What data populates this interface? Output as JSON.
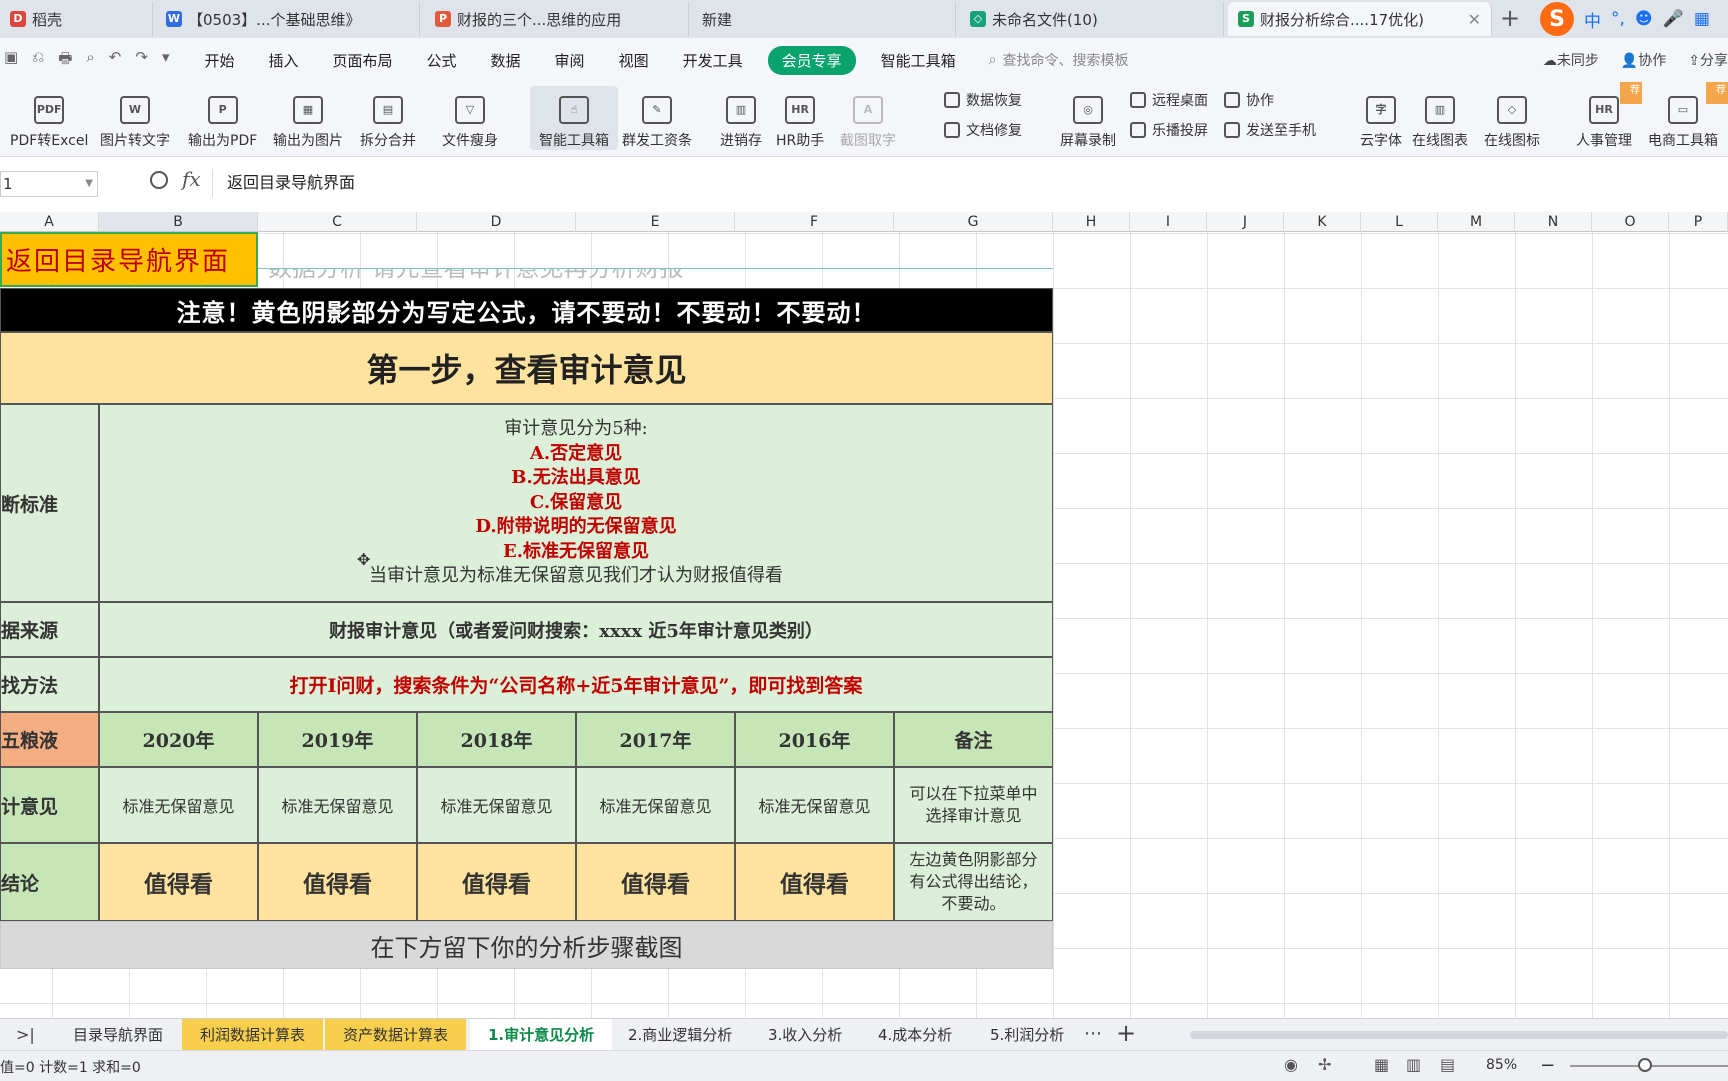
{
  "browser_tabs": [
    {
      "label": "稻壳",
      "icon_color": "#e0453d",
      "icon": "D"
    },
    {
      "label": "【0503】...个基础思维》",
      "icon_color": "#2f6de1",
      "icon": "W"
    },
    {
      "label": "财报的三个...思维的应用",
      "icon_color": "#e15a3d",
      "icon": "P"
    },
    {
      "label": "新建",
      "icon_color": "",
      "icon": ""
    },
    {
      "label": "未命名文件(10)",
      "icon_color": "#16a37a",
      "icon": "◇"
    },
    {
      "label": "财报分析综合....17优化)",
      "icon_color": "#1b9e5a",
      "icon": "S"
    }
  ],
  "ime": {
    "logo": "S",
    "mode": "中"
  },
  "quick_access": [
    "▣",
    "⎌",
    "🖶",
    "⌕",
    "↶",
    "↷",
    "▾"
  ],
  "menu": [
    "开始",
    "插入",
    "页面布局",
    "公式",
    "数据",
    "审阅",
    "视图",
    "开发工具",
    "会员专享",
    "智能工具箱"
  ],
  "search_placeholder": "查找命令、搜索模板",
  "menu_right": [
    "未同步",
    "协作",
    "分享"
  ],
  "ribbon": {
    "big": [
      {
        "label": "PDF转Excel",
        "icon": "PDF"
      },
      {
        "label": "图片转文字",
        "icon": "W"
      },
      {
        "label": "输出为PDF",
        "icon": "P"
      },
      {
        "label": "输出为图片",
        "icon": "▦"
      },
      {
        "label": "拆分合并",
        "icon": "▤"
      },
      {
        "label": "文件瘦身",
        "icon": "▽"
      },
      {
        "label": "智能工具箱",
        "icon": "☝"
      },
      {
        "label": "群发工资条",
        "icon": "✎"
      },
      {
        "label": "进销存",
        "icon": "▥"
      },
      {
        "label": "HR助手",
        "icon": "HR"
      },
      {
        "label": "截图取字",
        "icon": "A"
      },
      {
        "label": "屏幕录制",
        "icon": "◎"
      },
      {
        "label": "云字体",
        "icon": "字"
      },
      {
        "label": "在线图表",
        "icon": "▥"
      },
      {
        "label": "在线图标",
        "icon": "◇"
      },
      {
        "label": "人事管理",
        "icon": "HR"
      },
      {
        "label": "电商工具箱",
        "icon": "▭"
      }
    ],
    "small": [
      "数据恢复",
      "文档修复",
      "远程桌面",
      "乐播投屏",
      "协作",
      "发送至手机"
    ],
    "badge": "荐"
  },
  "formula_bar": {
    "cell_ref": "1",
    "fx": "fx",
    "content": "返回目录导航界面"
  },
  "columns": [
    "A",
    "B",
    "C",
    "D",
    "E",
    "F",
    "G",
    "H",
    "I",
    "J",
    "K",
    "L",
    "M",
    "N",
    "O",
    "P"
  ],
  "sheet": {
    "back_button": "返回目录导航界面",
    "faded_row": "数据分析 请先查看审计意见再分析财报",
    "warning": "注意！黄色阴影部分为写定公式，请不要动！不要动！不要动！",
    "step_title": "第一步，查看审计意见",
    "criteria_label": "断标准",
    "criteria_intro": "审计意见分为5种:",
    "opinions": [
      "A.否定意见",
      "B.无法出具意见",
      "C.保留意见",
      "D.附带说明的无保留意见",
      "E.标准无保留意见"
    ],
    "criteria_outro": "当审计意见为标准无保留意见我们才认为财报值得看",
    "source_label": "据来源",
    "source_text": "财报审计意见（或者爱问财搜索：xxxx 近5年审计意见类别）",
    "method_label": "找方法",
    "method_text": "打开I问财，搜索条件为“公司名称+近5年审计意见”，即可找到答案",
    "company_label": "五粮液",
    "years": [
      "2020年",
      "2019年",
      "2018年",
      "2017年",
      "2016年"
    ],
    "note_header": "备注",
    "audit_label": "计意见",
    "audit_values": [
      "标准无保留意见",
      "标准无保留意见",
      "标准无保留意见",
      "标准无保留意见",
      "标准无保留意见"
    ],
    "audit_note": "可以在下拉菜单中选择审计意见",
    "conclusion_label": "结论",
    "conclusion_values": [
      "值得看",
      "值得看",
      "值得看",
      "值得看",
      "值得看"
    ],
    "conclusion_note": "左边黄色阴影部分有公式得出结论，不要动。",
    "footer_text": "在下方留下你的分析步骤截图"
  },
  "sheet_tabs": [
    {
      "label": "目录导航界面",
      "style": "normal"
    },
    {
      "label": "利润数据计算表",
      "style": "yellow"
    },
    {
      "label": "资产数据计算表",
      "style": "yellow"
    },
    {
      "label": "1.审计意见分析",
      "style": "active"
    },
    {
      "label": "2.商业逻辑分析",
      "style": "normal"
    },
    {
      "label": "3.收入分析",
      "style": "normal"
    },
    {
      "label": "4.成本分析",
      "style": "normal"
    },
    {
      "label": "5.利润分析",
      "style": "normal"
    }
  ],
  "status": {
    "left": "值=0 计数=1 求和=0",
    "zoom": "85%"
  }
}
